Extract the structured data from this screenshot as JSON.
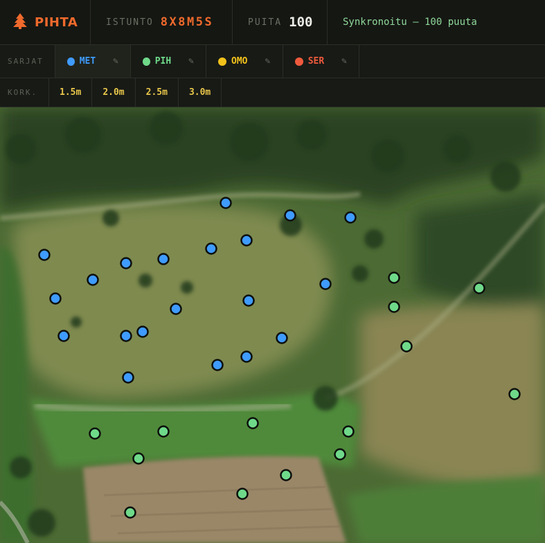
{
  "app": {
    "name": "PIHTA",
    "logo_icon": "tree-icon",
    "accent": "#ef6a2c"
  },
  "stats": {
    "session_label": "ISTUNTO",
    "session_value": "8X8M5S",
    "count_label": "PUITA",
    "count_value": "100",
    "sync_text": "Synkronoitu — 100 puuta"
  },
  "series": {
    "label": "SARJAT",
    "items": [
      {
        "code": "MET",
        "color": "#3f9bff",
        "edit_icon": "pencil-icon"
      },
      {
        "code": "PIH",
        "color": "#6fd98a",
        "edit_icon": "pencil-icon"
      },
      {
        "code": "OMO",
        "color": "#f2c21b",
        "edit_icon": "pencil-icon"
      },
      {
        "code": "SER",
        "color": "#ef5a3c",
        "edit_icon": "pencil-icon"
      }
    ],
    "active": "MET"
  },
  "heights": {
    "label": "KORK.",
    "items": [
      "1.5m",
      "2.0m",
      "2.5m",
      "3.0m"
    ]
  },
  "map": {
    "background": "aerial-forest-clearing",
    "markers": {
      "MET": [
        [
          326,
          138
        ],
        [
          419,
          156
        ],
        [
          506,
          159
        ],
        [
          64,
          213
        ],
        [
          182,
          225
        ],
        [
          236,
          219
        ],
        [
          305,
          204
        ],
        [
          356,
          192
        ],
        [
          134,
          249
        ],
        [
          80,
          276
        ],
        [
          254,
          291
        ],
        [
          359,
          279
        ],
        [
          470,
          255
        ],
        [
          92,
          330
        ],
        [
          182,
          330
        ],
        [
          206,
          324
        ],
        [
          407,
          333
        ],
        [
          314,
          372
        ],
        [
          356,
          360
        ],
        [
          185,
          390
        ]
      ],
      "PIH": [
        [
          569,
          246
        ],
        [
          692,
          261
        ],
        [
          569,
          288
        ],
        [
          587,
          345
        ],
        [
          743,
          414
        ],
        [
          365,
          456
        ],
        [
          503,
          468
        ],
        [
          137,
          471
        ],
        [
          236,
          468
        ],
        [
          491,
          501
        ],
        [
          200,
          507
        ],
        [
          413,
          531
        ],
        [
          350,
          558
        ],
        [
          188,
          585
        ]
      ]
    }
  }
}
